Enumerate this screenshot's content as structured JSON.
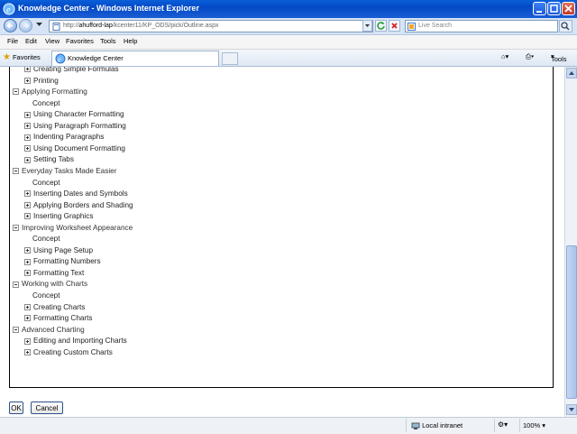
{
  "window": {
    "title": "Knowledge Center - Windows Internet Explorer"
  },
  "address": {
    "url_prefix": "http://",
    "url_host": "ahufford-lap",
    "url_path": "/kcenter11/KP_ODS/pick/Outline.aspx"
  },
  "search": {
    "placeholder": "Live Search"
  },
  "menu": [
    "File",
    "Edit",
    "View",
    "Favorites",
    "Tools",
    "Help"
  ],
  "favorites": {
    "label": "Favorites"
  },
  "tab": {
    "label": "Knowledge Center"
  },
  "toolbar": {
    "tools_label": "Tools"
  },
  "outline": [
    {
      "label": "Creating Simple Formulas",
      "level": 1,
      "toggle": "plus"
    },
    {
      "label": "Printing",
      "level": 1,
      "toggle": "plus"
    },
    {
      "label": "Applying Formatting",
      "level": 0,
      "toggle": "minus"
    },
    {
      "label": "Concept",
      "level": 1,
      "toggle": "none"
    },
    {
      "label": "Using Character Formatting",
      "level": 1,
      "toggle": "plus"
    },
    {
      "label": "Using Paragraph Formatting",
      "level": 1,
      "toggle": "plus"
    },
    {
      "label": "Indenting Paragraphs",
      "level": 1,
      "toggle": "plus"
    },
    {
      "label": "Using Document Formatting",
      "level": 1,
      "toggle": "plus"
    },
    {
      "label": "Setting Tabs",
      "level": 1,
      "toggle": "plus"
    },
    {
      "label": "Everyday Tasks Made Easier",
      "level": 0,
      "toggle": "minus"
    },
    {
      "label": "Concept",
      "level": 1,
      "toggle": "none"
    },
    {
      "label": "Inserting Dates and Symbols",
      "level": 1,
      "toggle": "plus"
    },
    {
      "label": "Applying Borders and Shading",
      "level": 1,
      "toggle": "plus"
    },
    {
      "label": "Inserting Graphics",
      "level": 1,
      "toggle": "plus"
    },
    {
      "label": "Improving Worksheet Appearance",
      "level": 0,
      "toggle": "minus"
    },
    {
      "label": "Concept",
      "level": 1,
      "toggle": "none"
    },
    {
      "label": "Using Page Setup",
      "level": 1,
      "toggle": "plus"
    },
    {
      "label": "Formatting Numbers",
      "level": 1,
      "toggle": "plus"
    },
    {
      "label": "Formatting Text",
      "level": 1,
      "toggle": "plus"
    },
    {
      "label": "Working with Charts",
      "level": 0,
      "toggle": "minus"
    },
    {
      "label": "Concept",
      "level": 1,
      "toggle": "none"
    },
    {
      "label": "Creating Charts",
      "level": 1,
      "toggle": "plus"
    },
    {
      "label": "Formatting Charts",
      "level": 1,
      "toggle": "plus"
    },
    {
      "label": "Advanced Charting",
      "level": 0,
      "toggle": "minus"
    },
    {
      "label": "Editing and Importing Charts",
      "level": 1,
      "toggle": "plus"
    },
    {
      "label": "Creating Custom Charts",
      "level": 1,
      "toggle": "plus"
    }
  ],
  "buttons": {
    "ok": "OK",
    "cancel": "Cancel"
  },
  "status": {
    "zone": "Local intranet",
    "zoom": "100%"
  },
  "colors": {
    "titlebar": "#0349c5",
    "chrome": "#d7e4f5"
  }
}
